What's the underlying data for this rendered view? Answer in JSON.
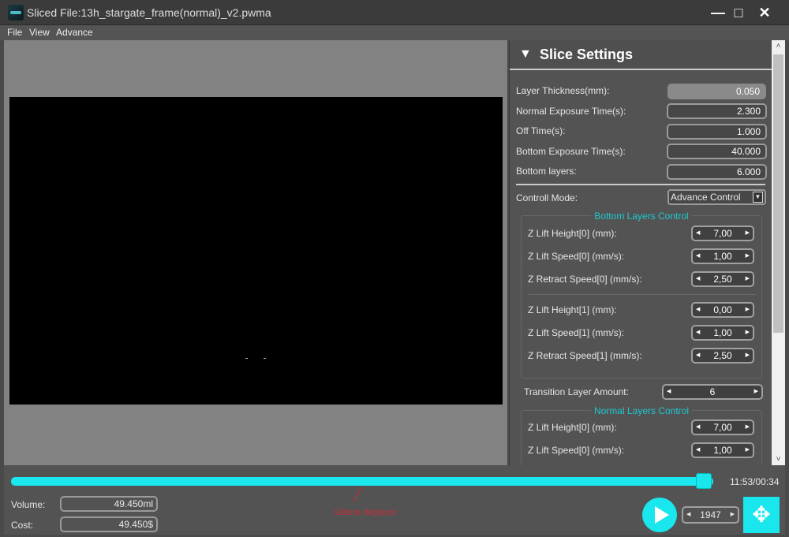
{
  "window": {
    "title": "Sliced File:13h_stargate_frame(normal)_v2.pwma",
    "minimize": "—",
    "maximize": "□",
    "close": "✕"
  },
  "menu": [
    "File",
    "View",
    "Advance"
  ],
  "panel": {
    "title": "Slice Settings",
    "collapse_icon": "▼",
    "fields": [
      {
        "label": "Layer Thickness(mm):",
        "value": "0.050",
        "readonly": true
      },
      {
        "label": "Normal Exposure Time(s):",
        "value": "2.300"
      },
      {
        "label": "Off Time(s):",
        "value": "1.000"
      },
      {
        "label": "Bottom Exposure Time(s):",
        "value": "40.000"
      },
      {
        "label": "Bottom layers:",
        "value": "6.000"
      }
    ],
    "control_mode": {
      "label": "Controll Mode:",
      "value": "Advance Control"
    },
    "bottom_group": {
      "title": "Bottom Layers Control",
      "rows": [
        {
          "label": "Z Lift Height[0] (mm):",
          "value": "7,00"
        },
        {
          "label": "Z Lift Speed[0] (mm/s):",
          "value": "1,00"
        },
        {
          "label": "Z Retract Speed[0] (mm/s):",
          "value": "2,50"
        },
        {
          "label": "Z Lift Height[1] (mm):",
          "value": "0,00"
        },
        {
          "label": "Z Lift Speed[1] (mm/s):",
          "value": "1,00"
        },
        {
          "label": "Z Retract Speed[1] (mm/s):",
          "value": "2,50"
        }
      ]
    },
    "transition": {
      "label": "Transition Layer Amount:",
      "value": "6"
    },
    "normal_group": {
      "title": "Normal Layers Control",
      "rows": [
        {
          "label": "Z Lift Height[0] (mm):",
          "value": "7,00"
        },
        {
          "label": "Z Lift Speed[0] (mm/s):",
          "value": "1,00"
        }
      ]
    }
  },
  "bottom": {
    "slider_progress": 0.99,
    "time": "11:53/00:34",
    "volume_label": "Volume:",
    "volume": "49.450ml",
    "cost_label": "Cost:",
    "cost": "49.450$",
    "annotation": "Slidera déplacer",
    "layer": "1947"
  },
  "colors": {
    "accent": "#1ae6ee",
    "annotation": "#c0303a"
  }
}
